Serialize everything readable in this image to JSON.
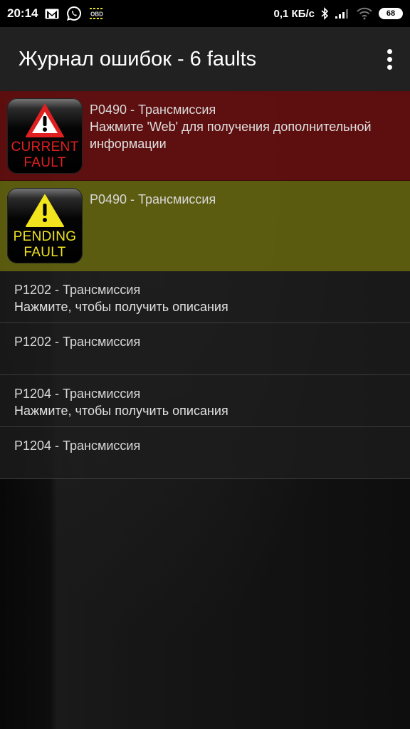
{
  "status_bar": {
    "time": "20:14",
    "notification_icons": [
      "gmail-icon",
      "whatsapp-icon",
      "obd-icon"
    ],
    "obd_label": "OBD",
    "network_speed": "0,1 КБ/с",
    "system_icons": [
      "bluetooth-icon",
      "cellular-signal-icon",
      "wifi-icon",
      "battery-icon"
    ],
    "battery_level": "68"
  },
  "app_bar": {
    "title": "Журнал ошибок - 6 faults",
    "overflow_icon": "more-vert-icon"
  },
  "faults": [
    {
      "type": "current",
      "badge_line1": "CURRENT",
      "badge_line2": "FAULT",
      "code": "P0490 - Трансмиссия",
      "description": "Нажмите 'Web' для получения дополнительной информации",
      "color": "#640e0e"
    },
    {
      "type": "pending",
      "badge_line1": "PENDING",
      "badge_line2": "FAULT",
      "code": "P0490 - Трансмиссия",
      "description": "",
      "color": "#626210"
    },
    {
      "type": "plain",
      "code": "P1202 - Трансмиссия",
      "description": "Нажмите, чтобы получить описания"
    },
    {
      "type": "plain",
      "code": "P1202 - Трансмиссия",
      "description": ""
    },
    {
      "type": "plain",
      "code": "P1204 - Трансмиссия",
      "description": "Нажмите, чтобы получить описания"
    },
    {
      "type": "plain",
      "code": "P1204 - Трансмиссия",
      "description": ""
    }
  ]
}
